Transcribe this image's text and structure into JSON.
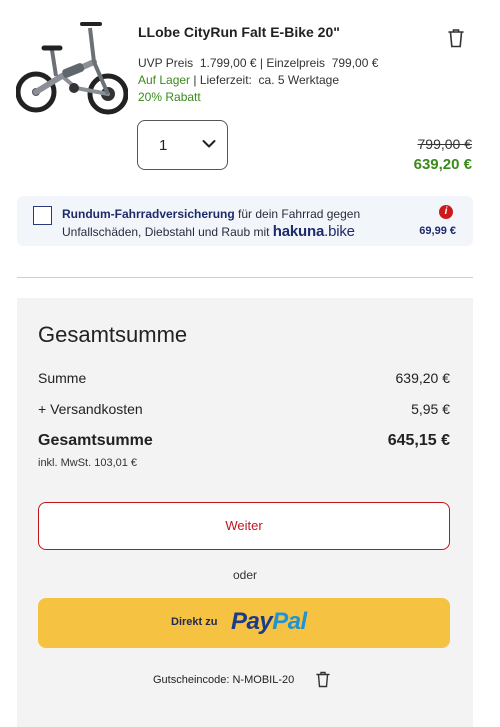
{
  "product": {
    "title": "LLobe CityRun Falt E-Bike 20\"",
    "image": "folding-ebike-image",
    "uvp_label": "UVP Preis",
    "uvp_value": "1.799,00 €",
    "einzel_label": "| Einzelpreis",
    "einzel_value": "799,00 €",
    "stock_status": "Auf Lager",
    "delivery_label": "| Lieferzeit:",
    "delivery_value": "ca. 5 Werktage",
    "discount": "20% Rabatt",
    "quantity": "1",
    "old_price": "799,00 €",
    "new_price": "639,20 €",
    "colors": {
      "green": "#3a8a1c"
    }
  },
  "insurance": {
    "brand_text": "Rundum-Fahrradversicherung",
    "text_rest": "für dein Fahrrad gegen Unfallschäden, Diebstahl und Raub mit",
    "partner_main": "hakuna",
    "partner_suffix": ".bike",
    "info_glyph": "i",
    "price": "69,99 €",
    "checked": false
  },
  "summary": {
    "heading": "Gesamtsumme",
    "rows": [
      {
        "label": "Summe",
        "value": "639,20 €"
      },
      {
        "label": "+ Versandkosten",
        "value": "5,95 €"
      }
    ],
    "total_label": "Gesamtsumme",
    "total_value": "645,15 €",
    "vat": "inkl. MwSt. 103,01 €",
    "continue_button": "Weiter",
    "or_text": "oder",
    "paypal_prefix": "Direkt zu",
    "paypal_pay": "Pay",
    "paypal_pal": "Pal",
    "coupon": "Gutscheincode: N-MOBIL-20",
    "colors": {
      "accent_red": "#c0141c",
      "paypal_yellow": "#f5c242"
    }
  }
}
